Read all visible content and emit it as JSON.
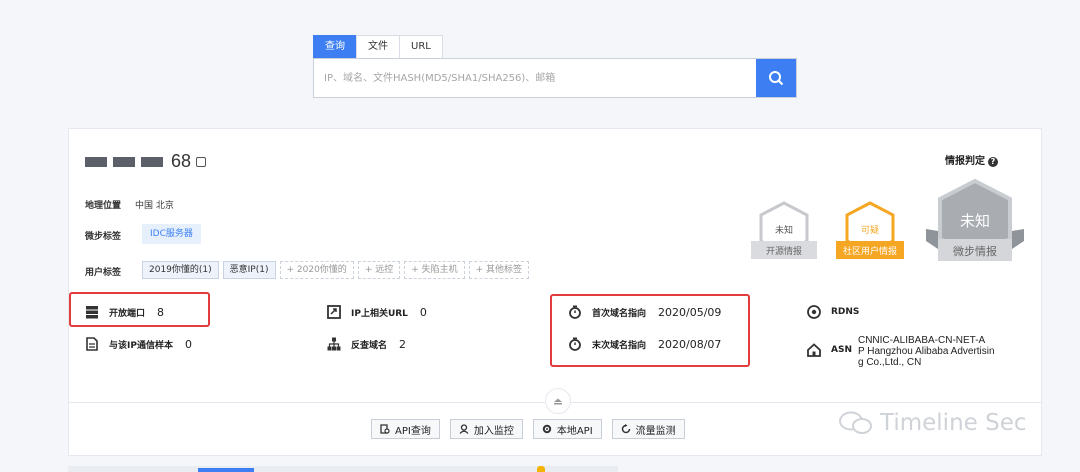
{
  "search": {
    "tabs": [
      "查询",
      "文件",
      "URL"
    ],
    "placeholder": "IP、域名、文件HASH(MD5/SHA1/SHA256)、邮箱"
  },
  "ip": {
    "suffix": "68"
  },
  "location": {
    "label": "地理位置",
    "value": "中国 北京"
  },
  "micro_tags": {
    "label": "微步标签",
    "value": "IDC服务器"
  },
  "user_tags": {
    "label": "用户标签",
    "tags": [
      "2019你懂的(1)",
      "恶意IP(1)"
    ],
    "add": [
      "+ 2020你懂的",
      "+ 远控",
      "+ 失陷主机",
      "+ 其他标签"
    ]
  },
  "verdict": {
    "title": "情报判定",
    "badges": [
      {
        "top": "未知",
        "bottom": "开源情报",
        "color": "#c7c9cc"
      },
      {
        "top": "可疑",
        "bottom": "社区用户情报",
        "color": "#f5a623"
      },
      {
        "top": "未知",
        "bottom": "微步情报",
        "color": "#a9adb2"
      }
    ]
  },
  "stats": {
    "open_ports": {
      "label": "开放端口",
      "value": "8"
    },
    "related_url": {
      "label": "IP上相关URL",
      "value": "0"
    },
    "first_seen": {
      "label": "首次域名指向",
      "value": "2020/05/09"
    },
    "rdns": {
      "label": "RDNS"
    },
    "samples": {
      "label": "与该IP通信样本",
      "value": "0"
    },
    "reverse_domain": {
      "label": "反查域名",
      "value": "2"
    },
    "last_seen": {
      "label": "末次域名指向",
      "value": "2020/08/07"
    },
    "asn": {
      "label": "ASN",
      "lines": [
        "CNNIC-ALIBABA-CN-NET-A",
        "P Hangzhou Alibaba Advertisin",
        "g Co.,Ltd., CN"
      ]
    }
  },
  "actions": [
    "API查询",
    "加入监控",
    "本地API",
    "流量监测"
  ],
  "watermark": "Timeline Sec",
  "colors": {
    "accent": "#3d7ff2",
    "highlight": "#e23c3c",
    "suspicious": "#f5a623"
  }
}
